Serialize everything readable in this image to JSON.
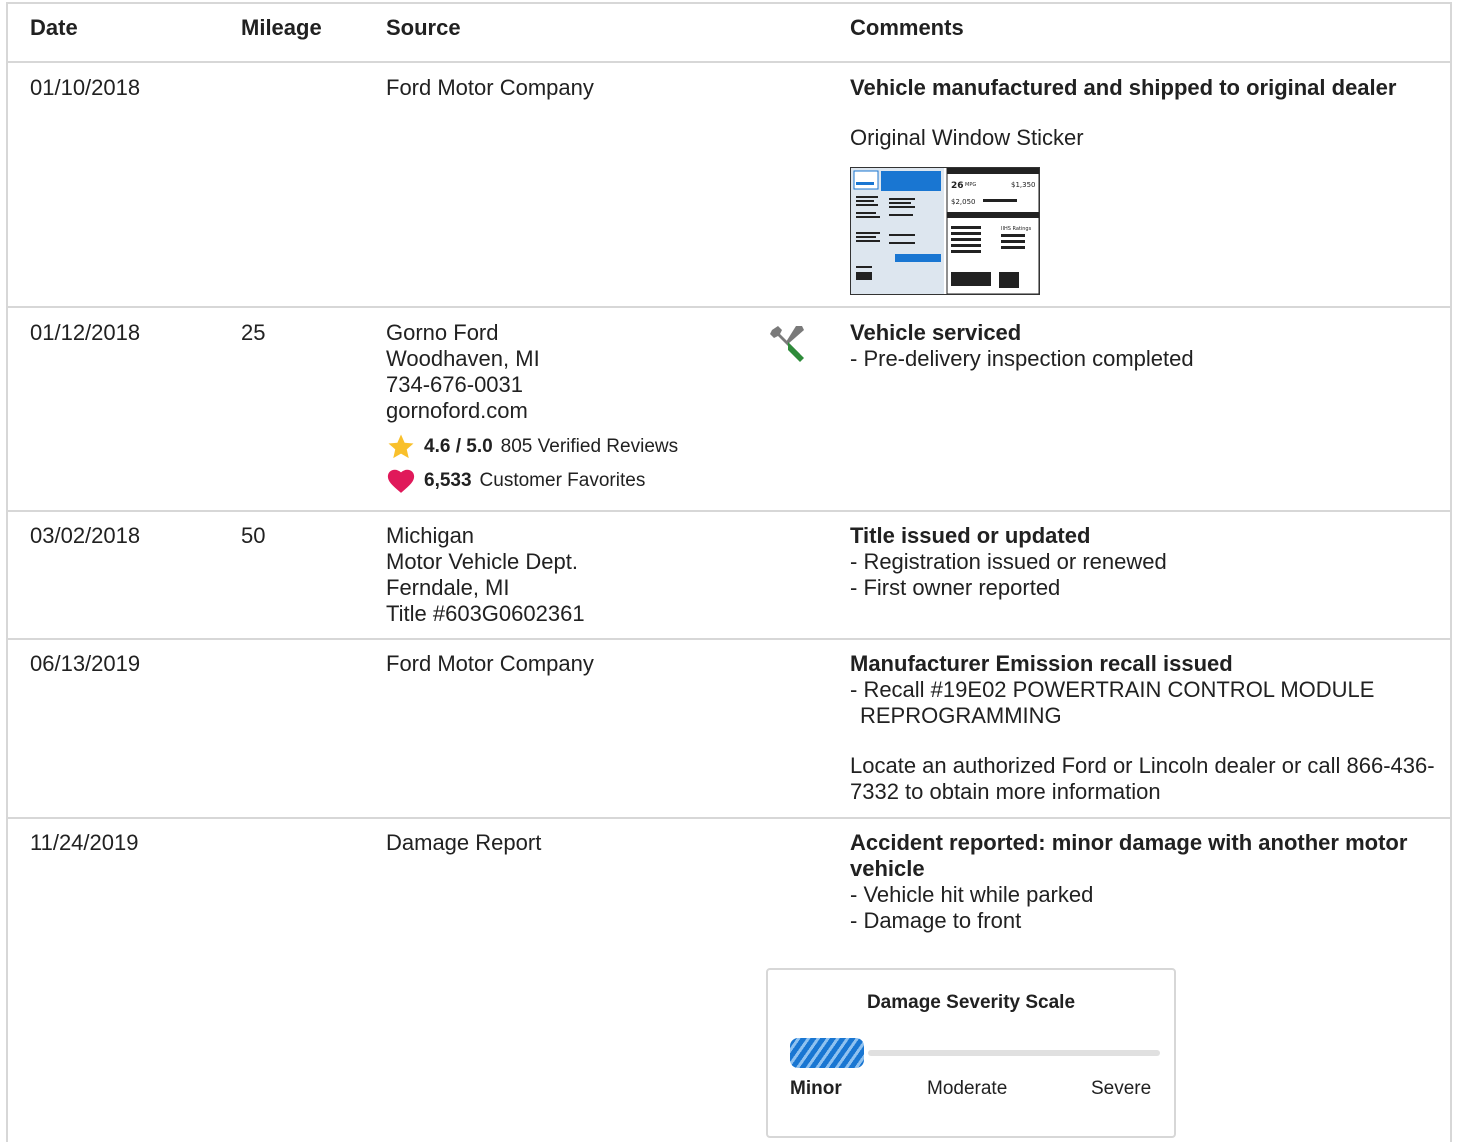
{
  "headers": {
    "date": "Date",
    "mileage": "Mileage",
    "source": "Source",
    "comments": "Comments"
  },
  "rows": [
    {
      "date": "01/10/2018",
      "mileage": "",
      "source": [
        "Ford Motor Company"
      ],
      "comment_title": "Vehicle manufactured and shipped to original dealer",
      "sticker_label": "Original Window Sticker",
      "sticker": {
        "mpg": "26",
        "mpg_unit": "MPG",
        "save": "$1,350",
        "spend": "$2,050",
        "ratings": "IIHS Ratings"
      }
    },
    {
      "date": "01/12/2018",
      "mileage": "25",
      "source": [
        "Gorno Ford",
        "Woodhaven, MI",
        "734-676-0031",
        "gornoford.com"
      ],
      "rating_value": "4.6 / 5.0",
      "rating_text": "805 Verified Reviews",
      "favorites_value": "6,533",
      "favorites_text": "Customer Favorites",
      "icon": "wrench-screwdriver-icon",
      "comment_title": "Vehicle serviced",
      "bullets": [
        "- Pre-delivery inspection completed"
      ]
    },
    {
      "date": "03/02/2018",
      "mileage": "50",
      "source": [
        "Michigan",
        "Motor Vehicle Dept.",
        "Ferndale, MI",
        "Title #603G0602361"
      ],
      "comment_title": "Title issued or updated",
      "bullets": [
        "- Registration issued or renewed",
        "- First owner reported"
      ]
    },
    {
      "date": "06/13/2019",
      "mileage": "",
      "source": [
        "Ford Motor Company"
      ],
      "comment_title": "Manufacturer Emission recall issued",
      "bullets": [
        "- Recall #19E02 POWERTRAIN CONTROL MODULE REPROGRAMMING"
      ],
      "note": "Locate an authorized Ford or Lincoln dealer or call 866-436-7332 to obtain more information"
    },
    {
      "date": "11/24/2019",
      "mileage": "",
      "source": [
        "Damage Report"
      ],
      "comment_title": "Accident reported: minor damage with another motor vehicle",
      "bullets": [
        "- Vehicle hit while parked",
        "- Damage to front"
      ]
    }
  ],
  "severity": {
    "title": "Damage Severity Scale",
    "labels": [
      "Minor",
      "Moderate",
      "Severe"
    ],
    "level": "Minor",
    "level_fraction": 0.25
  },
  "colors": {
    "star": "#f9c02b",
    "heart": "#e0195a",
    "severity_fill": "#1976d2",
    "border": "#d7d7d7"
  }
}
